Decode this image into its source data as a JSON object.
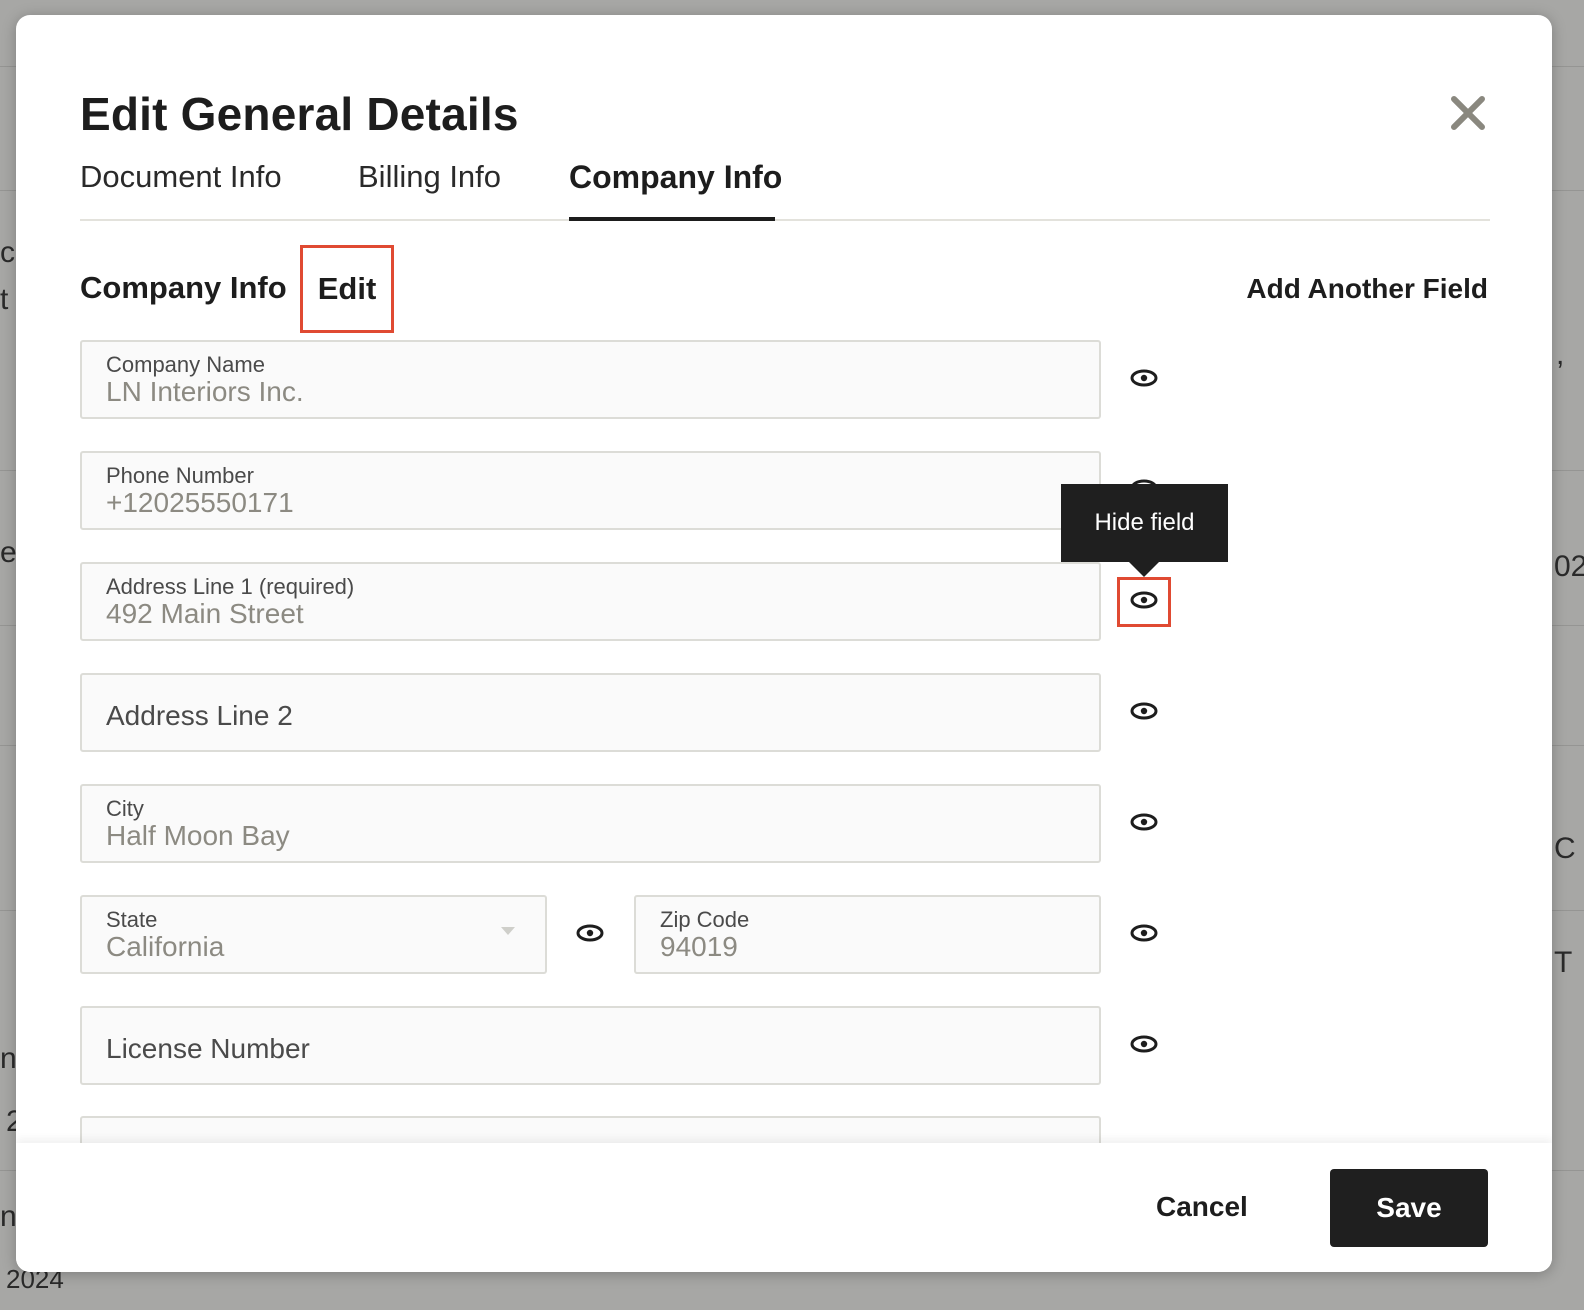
{
  "background": {
    "fragments": [
      "c",
      "t",
      "e",
      "n",
      "2",
      "n",
      "2024",
      ",",
      "02",
      "C",
      "T"
    ]
  },
  "dialog": {
    "title": "Edit General Details",
    "tabs": [
      {
        "label": "Document Info",
        "active": false
      },
      {
        "label": "Billing Info",
        "active": false
      },
      {
        "label": "Company Info",
        "active": true
      }
    ],
    "section_title": "Company Info",
    "edit_label": "Edit",
    "add_field_label": "Add Another Field",
    "fields": {
      "company_name": {
        "label": "Company Name",
        "value": "LN Interiors Inc."
      },
      "phone_number": {
        "label": "Phone Number",
        "value": "+12025550171"
      },
      "address_line_1": {
        "label": "Address Line 1 (required)",
        "value": "492 Main Street"
      },
      "address_line_2": {
        "placeholder": "Address Line 2"
      },
      "city": {
        "label": "City",
        "value": "Half Moon Bay"
      },
      "state": {
        "label": "State",
        "value": "California"
      },
      "zip_code": {
        "label": "Zip Code",
        "value": "94019"
      },
      "license_number": {
        "placeholder": "License Number"
      }
    },
    "tooltip": "Hide field",
    "footer": {
      "cancel_label": "Cancel",
      "save_label": "Save"
    }
  },
  "colors": {
    "accent_highlight": "#e04a32",
    "primary_button": "#1f1f1f",
    "field_value_text": "#8c8a82"
  },
  "icons": [
    "close-icon",
    "eye-icon",
    "chevron-down-icon"
  ]
}
